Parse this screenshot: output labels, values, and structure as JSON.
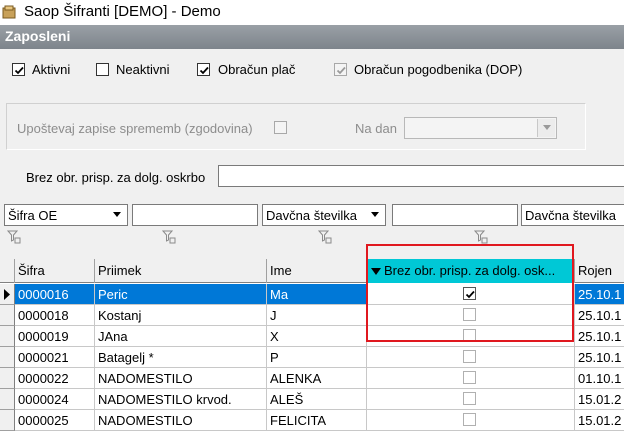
{
  "window": {
    "title": "Saop Šifranti [DEMO] - Demo"
  },
  "panel": {
    "title": "Zaposleni"
  },
  "filters": {
    "aktivni": {
      "label": "Aktivni",
      "checked": true
    },
    "neaktivni": {
      "label": "Neaktivni",
      "checked": false
    },
    "obracun_plac": {
      "label": "Obračun plač",
      "checked": true
    },
    "obracun_pogodbenika": {
      "label": "Obračun pogodbenika (DOP)",
      "checked": true
    }
  },
  "history": {
    "label": "Upoštevaj zapise sprememb (zgodovina)",
    "na_dan_label": "Na dan"
  },
  "search": {
    "label": "Brez obr. prisp. za dolg. oskrbo",
    "value": ""
  },
  "column_filters": {
    "col1_select": "Šifra OE",
    "col2_select": "Davčna številka",
    "col3_select": "Davčna številka"
  },
  "grid": {
    "columns": [
      "Šifra",
      "Priimek",
      "Ime",
      "Brez obr. prisp. za dolg. osk...",
      "Rojen"
    ],
    "rows": [
      {
        "sifra": "0000016",
        "priimek": "Peric",
        "ime": "Ma",
        "brez": true,
        "rojen": "25.10.1"
      },
      {
        "sifra": "0000018",
        "priimek": "Kostanj",
        "ime": "J",
        "brez": false,
        "rojen": "25.10.1"
      },
      {
        "sifra": "0000019",
        "priimek": "JAna",
        "ime": "X",
        "brez": false,
        "rojen": "25.10.1"
      },
      {
        "sifra": "0000021",
        "priimek": "Batagelj *",
        "ime": "P",
        "brez": false,
        "rojen": "25.10.1"
      },
      {
        "sifra": "0000022",
        "priimek": "NADOMESTILO",
        "ime": "ALENKA",
        "brez": false,
        "rojen": "01.10.1"
      },
      {
        "sifra": "0000024",
        "priimek": "NADOMESTILO krvod.",
        "ime": "ALEŠ",
        "brez": false,
        "rojen": "15.01.2"
      },
      {
        "sifra": "0000025",
        "priimek": "NADOMESTILO",
        "ime": "FELICITA",
        "brez": false,
        "rojen": "15.01.2"
      }
    ]
  },
  "colors": {
    "selection": "#0078d7",
    "sorted_header": "#00c8d6",
    "highlight_box": "#e0181f"
  }
}
